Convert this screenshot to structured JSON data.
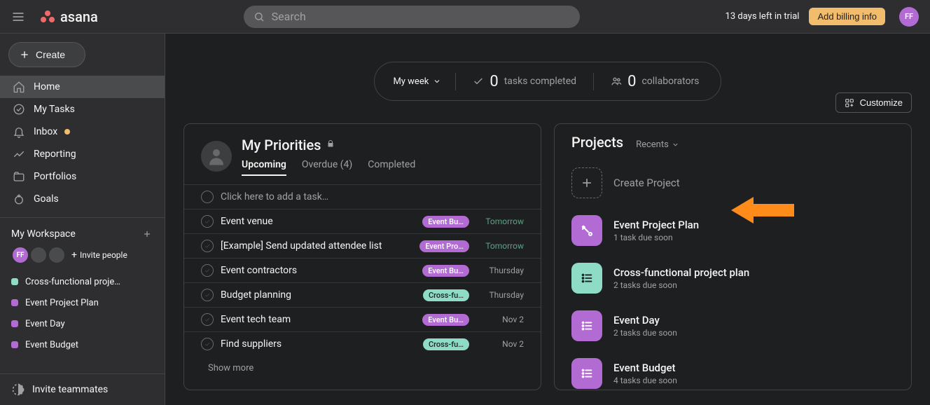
{
  "topbar": {
    "logo_text": "asana",
    "search_placeholder": "Search",
    "trial_text": "13 days left in trial",
    "billing_label": "Add billing info",
    "avatar_initials": "FF"
  },
  "sidebar": {
    "create_label": "Create",
    "nav": [
      {
        "label": "Home",
        "icon": "home",
        "active": true
      },
      {
        "label": "My Tasks",
        "icon": "check-circle"
      },
      {
        "label": "Inbox",
        "icon": "bell",
        "dot": true
      },
      {
        "label": "Reporting",
        "icon": "chart"
      },
      {
        "label": "Portfolios",
        "icon": "folder"
      },
      {
        "label": "Goals",
        "icon": "target"
      }
    ],
    "workspace_label": "My Workspace",
    "avatar_initials": "FF",
    "invite_label": "Invite people",
    "projects": [
      {
        "label": "Cross-functional proje…",
        "color": "#8edcc6"
      },
      {
        "label": "Event Project Plan",
        "color": "#b36bd4"
      },
      {
        "label": "Event Day",
        "color": "#b36bd4"
      },
      {
        "label": "Event Budget",
        "color": "#b36bd4"
      }
    ],
    "invite_teammates_label": "Invite teammates"
  },
  "summary": {
    "myweek_label": "My week",
    "tasks_number": "0",
    "tasks_label": "tasks completed",
    "collab_number": "0",
    "collab_label": "collaborators",
    "customize_label": "Customize"
  },
  "priorities": {
    "title": "My Priorities",
    "tabs": {
      "upcoming": "Upcoming",
      "overdue": "Overdue (4)",
      "completed": "Completed"
    },
    "add_task_placeholder": "Click here to add a task…",
    "show_more_label": "Show more",
    "tasks": [
      {
        "name": "Event venue",
        "tag": "Event Bu…",
        "tag_bg": "#b36bd4",
        "tag_fg": "#ffffff",
        "due": "Tomorrow",
        "due_green": true
      },
      {
        "name": "[Example] Send updated attendee list",
        "tag": "Event Pro…",
        "tag_bg": "#b36bd4",
        "tag_fg": "#ffffff",
        "due": "Tomorrow",
        "due_green": true
      },
      {
        "name": "Event contractors",
        "tag": "Event Bu…",
        "tag_bg": "#b36bd4",
        "tag_fg": "#ffffff",
        "due": "Thursday"
      },
      {
        "name": "Budget planning",
        "tag": "Cross-fu…",
        "tag_bg": "#8edcc6",
        "tag_fg": "#1e1f21",
        "due": "Thursday"
      },
      {
        "name": "Event tech team",
        "tag": "Event Bu…",
        "tag_bg": "#b36bd4",
        "tag_fg": "#ffffff",
        "due": "Nov 2"
      },
      {
        "name": "Find suppliers",
        "tag": "Cross-fu…",
        "tag_bg": "#8edcc6",
        "tag_fg": "#1e1f21",
        "due": "Nov 2"
      }
    ]
  },
  "projects_card": {
    "title": "Projects",
    "recents_label": "Recents",
    "create_label": "Create Project",
    "items": [
      {
        "name": "Event Project Plan",
        "sub": "1 task due soon",
        "bg": "#b36bd4",
        "icon": "squiggle"
      },
      {
        "name": "Cross-functional project plan",
        "sub": "2 tasks due soon",
        "bg": "#8edcc6",
        "icon": "list"
      },
      {
        "name": "Event Day",
        "sub": "2 tasks due soon",
        "bg": "#b36bd4",
        "icon": "list"
      },
      {
        "name": "Event Budget",
        "sub": "4 tasks due soon",
        "bg": "#b36bd4",
        "icon": "list"
      }
    ]
  },
  "colors": {
    "accent_orange": "#f1bd6c",
    "purple": "#b36bd4",
    "teal": "#8edcc6"
  }
}
